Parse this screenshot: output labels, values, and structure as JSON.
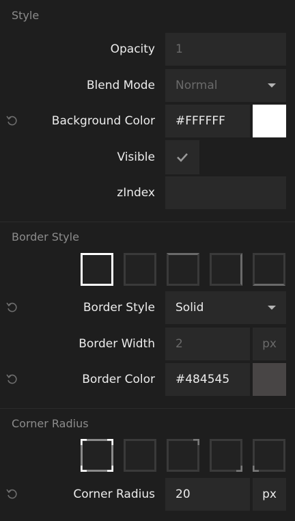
{
  "style": {
    "title": "Style",
    "opacity": {
      "label": "Opacity",
      "value": "1"
    },
    "blend_mode": {
      "label": "Blend Mode",
      "value": "Normal"
    },
    "background_color": {
      "label": "Background Color",
      "value": "#FFFFFF",
      "swatch": "#FFFFFF"
    },
    "visible": {
      "label": "Visible",
      "checked": true
    },
    "zindex": {
      "label": "zIndex",
      "value": ""
    }
  },
  "border": {
    "title": "Border Style",
    "presets": [
      "all-sides",
      "none",
      "top",
      "right",
      "bottom"
    ],
    "selected_preset": 0,
    "border_style": {
      "label": "Border Style",
      "value": "Solid"
    },
    "border_width": {
      "label": "Border Width",
      "value": "2",
      "unit": "px"
    },
    "border_color": {
      "label": "Border Color",
      "value": "#484545",
      "swatch": "#484545"
    }
  },
  "corner": {
    "title": "Corner Radius",
    "presets": [
      "all-corners",
      "none",
      "top-right",
      "bottom-right",
      "bottom-left"
    ],
    "selected_preset": 0,
    "corner_radius": {
      "label": "Corner Radius",
      "value": "20",
      "unit": "px"
    }
  }
}
